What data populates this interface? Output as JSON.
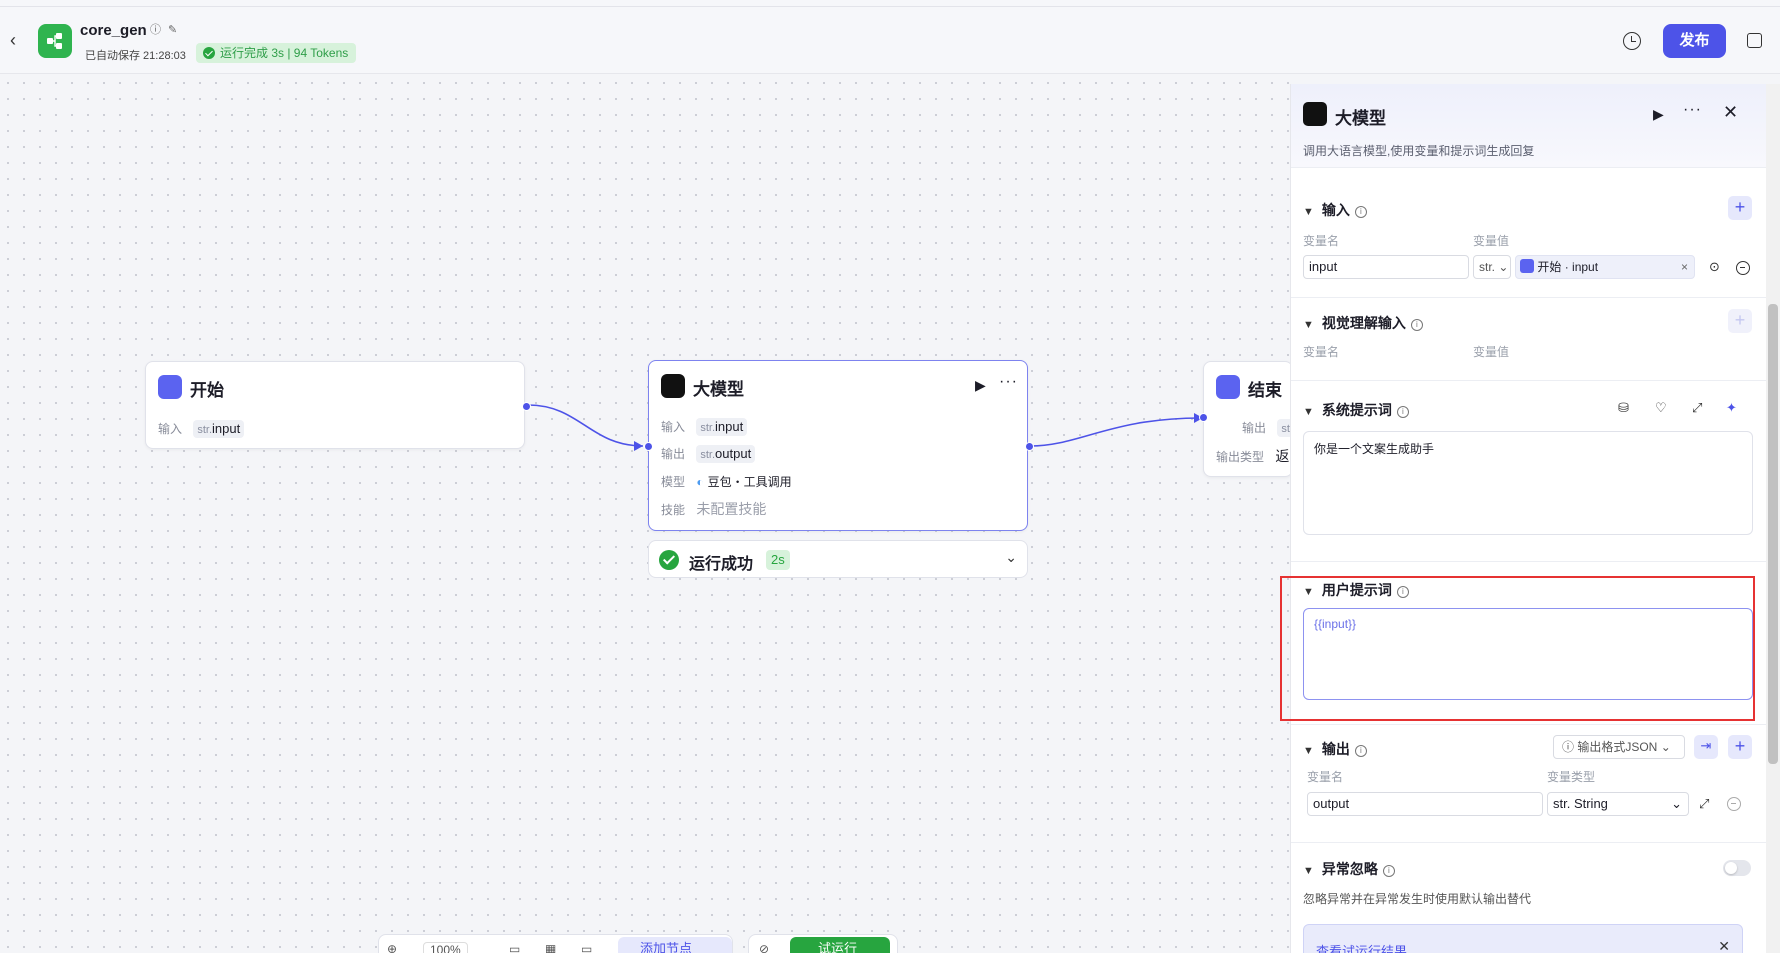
{
  "header": {
    "app_name": "core_gen",
    "autosave": "已自动保存 21:28:03",
    "run_status": "运行完成 3s | 94 Tokens",
    "publish_label": "发布"
  },
  "canvas": {
    "start_node": {
      "title": "开始",
      "input_label": "输入",
      "input_type": "str.",
      "input_name": "input"
    },
    "llm_node": {
      "title": "大模型",
      "input_label": "输入",
      "input_type": "str.",
      "input_name": "input",
      "output_label": "输出",
      "output_type": "str.",
      "output_name": "output",
      "model_label": "模型",
      "model_value": "豆包・工具调用",
      "skill_label": "技能",
      "skill_value": "未配置技能"
    },
    "end_node": {
      "title": "结束",
      "output_label": "输出",
      "output_type": "st",
      "output_type_label": "输出类型",
      "output_type_value": "返"
    },
    "run_status": {
      "text": "运行成功",
      "duration": "2s"
    },
    "toolbar": {
      "zoom": "100%",
      "add_node_label": "添加节点",
      "test_run_label": "试运行"
    }
  },
  "panel": {
    "title": "大模型",
    "description": "调用大语言模型,使用变量和提示词生成回复",
    "input_section": {
      "title": "输入",
      "col_name": "变量名",
      "col_value": "变量值",
      "var_name": "input",
      "var_type": "str.",
      "ref_node": "开始",
      "ref_var": "input"
    },
    "vision_section": {
      "title": "视觉理解输入",
      "col_name": "变量名",
      "col_value": "变量值"
    },
    "system_prompt": {
      "title": "系统提示词",
      "content": "你是一个文案生成助手"
    },
    "user_prompt": {
      "title": "用户提示词",
      "content": "{{input}}"
    },
    "output_section": {
      "title": "输出",
      "format_label": "输出格式JSON",
      "col_name": "变量名",
      "col_type": "变量类型",
      "var_name": "output",
      "var_type": "str. String"
    },
    "exception_section": {
      "title": "异常忽略",
      "description": "忽略异常并在异常发生时使用默认输出替代"
    },
    "view_result_label": "查看试运行结果"
  },
  "colors": {
    "accent": "#4d53e8",
    "success": "#27a53f",
    "highlight": "#e63232"
  }
}
